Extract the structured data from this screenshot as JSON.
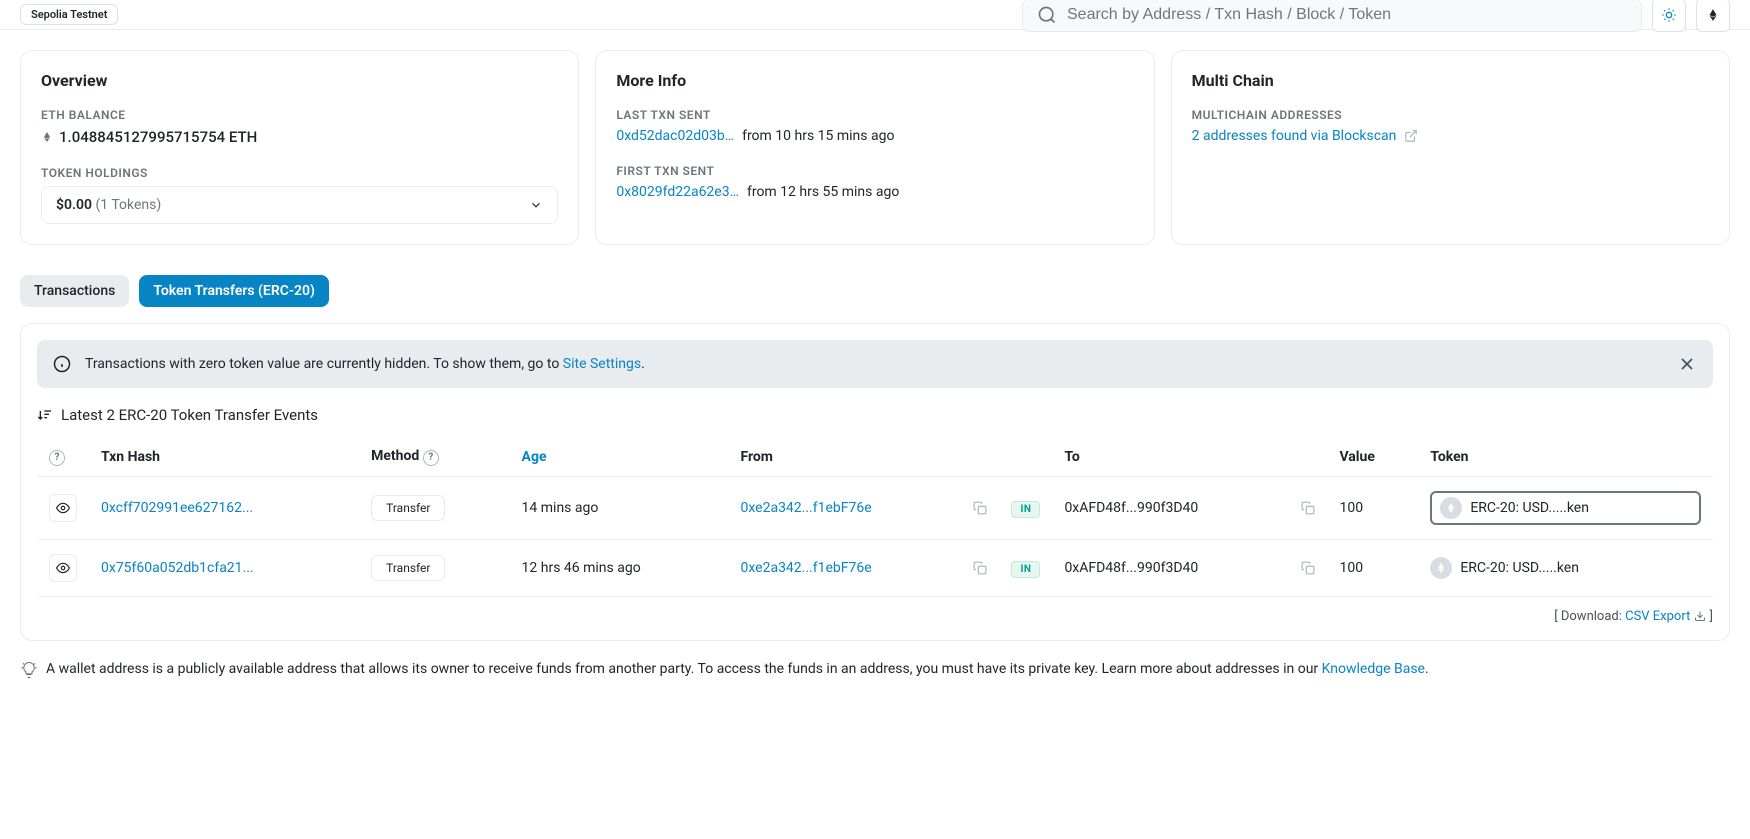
{
  "header": {
    "network_label": "Sepolia Testnet",
    "search_placeholder": "Search by Address / Txn Hash / Block / Token"
  },
  "overview": {
    "title": "Overview",
    "balance_label": "ETH BALANCE",
    "balance_value": "1.048845127995715754 ETH",
    "holdings_label": "TOKEN HOLDINGS",
    "holdings_value": "$0.00",
    "holdings_count": "(1 Tokens)"
  },
  "more_info": {
    "title": "More Info",
    "last_label": "LAST TXN SENT",
    "last_hash": "0xd52dac02d03b…",
    "last_time": "from 10 hrs 15 mins ago",
    "first_label": "FIRST TXN SENT",
    "first_hash": "0x8029fd22a62e3…",
    "first_time": "from 12 hrs 55 mins ago"
  },
  "multichain": {
    "title": "Multi Chain",
    "label": "MULTICHAIN ADDRESSES",
    "link": "2 addresses found via Blockscan"
  },
  "tabs": {
    "transactions": "Transactions",
    "token_transfers": "Token Transfers (ERC-20)"
  },
  "banner": {
    "text_before": "Transactions with zero token value are currently hidden. To show them, go to ",
    "link": "Site Settings",
    "text_after": "."
  },
  "events_header": "Latest 2 ERC-20 Token Transfer Events",
  "columns": {
    "txn_hash": "Txn Hash",
    "method": "Method",
    "age": "Age",
    "from": "From",
    "to": "To",
    "value": "Value",
    "token": "Token"
  },
  "rows": [
    {
      "hash": "0xcff702991ee627162...",
      "method": "Transfer",
      "age": "14 mins ago",
      "from": "0xe2a342...f1ebF76e",
      "direction": "IN",
      "to": "0xAFD48f...990f3D40",
      "value": "100",
      "token": "ERC-20: USD.....ken",
      "highlighted": true
    },
    {
      "hash": "0x75f60a052db1cfa21...",
      "method": "Transfer",
      "age": "12 hrs 46 mins ago",
      "from": "0xe2a342...f1ebF76e",
      "direction": "IN",
      "to": "0xAFD48f...990f3D40",
      "value": "100",
      "token": "ERC-20: USD.....ken",
      "highlighted": false
    }
  ],
  "download": {
    "prefix": "[ Download: ",
    "link": "CSV Export",
    "suffix": " ]"
  },
  "footer": {
    "text_before": "A wallet address is a publicly available address that allows its owner to receive funds from another party. To access the funds in an address, you must have its private key. Learn more about addresses in our ",
    "link": "Knowledge Base",
    "text_after": "."
  }
}
